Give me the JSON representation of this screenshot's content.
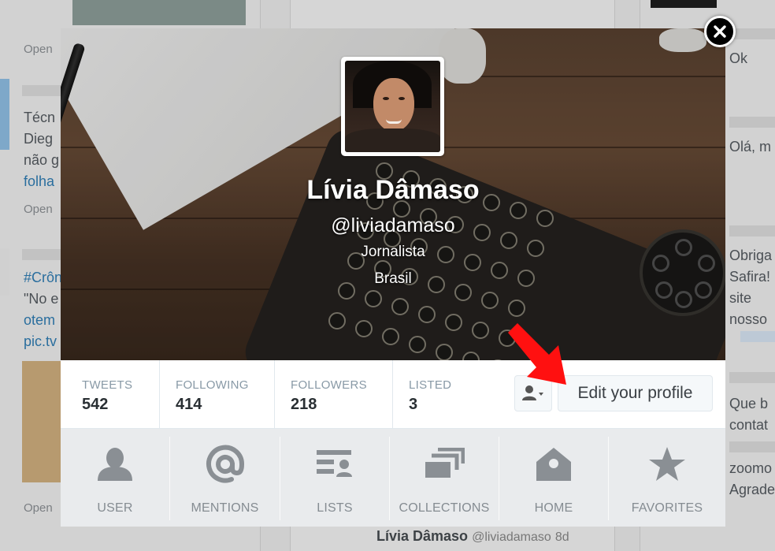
{
  "profile": {
    "name": "Lívia Dâmaso",
    "handle": "@liviadamaso",
    "bio": "Jornalista",
    "location": "Brasil"
  },
  "stats": [
    {
      "label": "TWEETS",
      "value": "542"
    },
    {
      "label": "FOLLOWING",
      "value": "414"
    },
    {
      "label": "FOLLOWERS",
      "value": "218"
    },
    {
      "label": "LISTED",
      "value": "3"
    }
  ],
  "actions": {
    "edit_profile": "Edit your profile"
  },
  "nav": [
    {
      "label": "USER",
      "icon": "user-icon"
    },
    {
      "label": "MENTIONS",
      "icon": "at-icon"
    },
    {
      "label": "LISTS",
      "icon": "lists-icon"
    },
    {
      "label": "COLLECTIONS",
      "icon": "collections-icon"
    },
    {
      "label": "HOME",
      "icon": "home-icon"
    },
    {
      "label": "FAVORITES",
      "icon": "star-icon"
    }
  ],
  "background": {
    "left": {
      "open_1": "Open",
      "tweet_line_1": "Técn",
      "tweet_line_2": "Dieg",
      "tweet_line_3": "não g",
      "tweet_line_4": "folha",
      "open_2": "Open",
      "tweet2_line_1": "#Crôn",
      "tweet2_line_2": "\"No e",
      "tweet2_line_3": "otem",
      "tweet2_line_4": "pic.tv",
      "open_3": "Open"
    },
    "right": {
      "line_1": "Ok",
      "line_2": "Olá, m",
      "line_3": "Obriga",
      "line_4": "Safira!",
      "line_5": "site",
      "line_6": "nosso",
      "line_7": "Que b",
      "line_8": "contat",
      "line_9": "zoomo",
      "line_10": "Agrade"
    },
    "bottom_author": "Lívia Dâmaso",
    "bottom_handle": "@liviadamaso",
    "bottom_time": "8d"
  },
  "colors": {
    "accent_arrow": "#ff0000",
    "stat_label": "#8899a6",
    "nav_background": "#e9ebed"
  }
}
